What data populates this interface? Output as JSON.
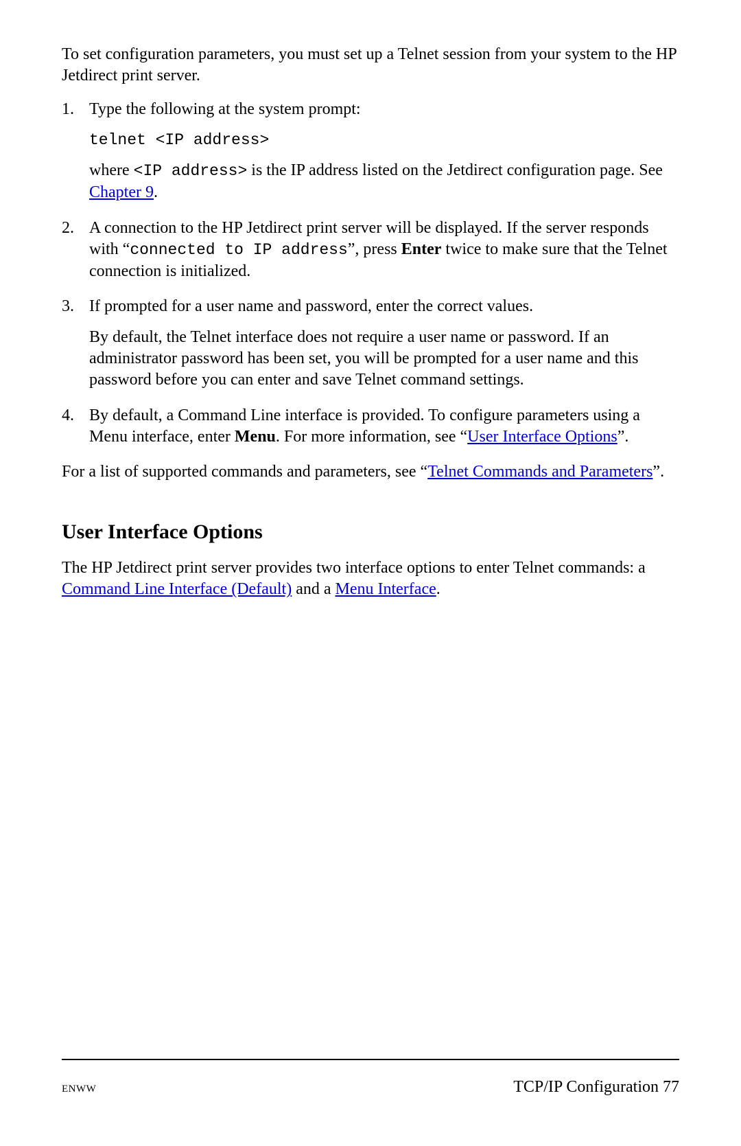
{
  "intro": "To set configuration parameters, you must set up a Telnet session from your system to the HP Jetdirect print server.",
  "steps": {
    "s1": {
      "num": "1.",
      "line1": "Type the following at the system prompt:",
      "cmd": "telnet <IP address>",
      "where_a": "where ",
      "where_code": "<IP address>",
      "where_b": " is the IP address listed on the Jetdirect configuration page.  See ",
      "where_link": "Chapter 9",
      "where_end": "."
    },
    "s2": {
      "num": "2.",
      "a": "A connection to the HP Jetdirect print server will be displayed. If the server responds with “",
      "code": "connected to IP address",
      "b": "”, press ",
      "enter": "Enter",
      "c": " twice to make sure that the Telnet connection is initialized."
    },
    "s3": {
      "num": "3.",
      "line1": "If prompted for a user name and password, enter the correct values.",
      "line2": "By default, the Telnet interface does not require a user name or password. If an administrator password has been set, you will be prompted for a user name and this password before you can enter and save Telnet command settings."
    },
    "s4": {
      "num": "4.",
      "a": "By default, a Command Line interface is provided. To configure parameters using a Menu interface, enter ",
      "menu": "Menu",
      "b": ". For more information, see “",
      "link": "User Interface Options",
      "c": "”."
    }
  },
  "after_list": {
    "a": "For a list of supported commands and parameters, see “",
    "link": "Telnet Commands and Parameters",
    "b": "”."
  },
  "heading": "User Interface Options",
  "opts": {
    "a": "The HP Jetdirect print server provides two interface options to enter Telnet commands: a ",
    "link1": "Command Line Interface (Default)",
    "b": " and a ",
    "link2": "Menu Interface",
    "c": "."
  },
  "footer": {
    "left": "ENWW",
    "right_label": "TCP/IP Configuration ",
    "page": "77"
  }
}
